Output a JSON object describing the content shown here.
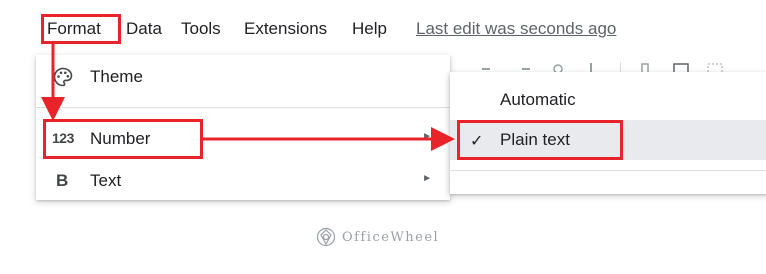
{
  "menubar": {
    "items": [
      "Format",
      "Data",
      "Tools",
      "Extensions",
      "Help"
    ],
    "last_edit": "Last edit was seconds ago"
  },
  "format_menu": {
    "items": [
      {
        "icon": "palette-icon",
        "label": "Theme",
        "submenu": false
      },
      {
        "icon": "number-123-icon",
        "label": "Number",
        "icon_text": "123",
        "submenu": true
      },
      {
        "icon": "bold-b-icon",
        "label": "Text",
        "icon_text": "B",
        "submenu": true
      }
    ]
  },
  "number_submenu": {
    "items": [
      {
        "label": "Automatic",
        "checked": false
      },
      {
        "label": "Plain text",
        "checked": true
      }
    ]
  },
  "watermark": {
    "text": "OfficeWheel"
  },
  "colors": {
    "highlight": "#e8232a",
    "selected_bg": "#e8eaed",
    "menu_text": "#202124"
  }
}
